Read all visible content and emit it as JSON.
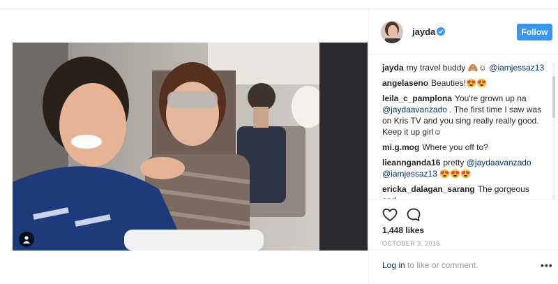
{
  "post": {
    "username": "jayda",
    "follow_label": "Follow",
    "likes": "1,448 likes",
    "date": "OCTOBER 3, 2016",
    "footer": {
      "login_link": "Log in",
      "login_rest": " to like or comment.",
      "more": "•••"
    }
  },
  "comments": [
    {
      "user": "jayda",
      "parts": [
        "my travel buddy 🙈☺ ",
        "@iamjessaz13"
      ]
    },
    {
      "user": "angelaseno",
      "parts": [
        "Beauties!😍😍"
      ]
    },
    {
      "user": "leila_c_pamplona",
      "parts": [
        "You're grown up na ",
        "@jaydaavanzado",
        " . The first time I saw was on Kris TV and you sing really really good. Keep it up girl☺"
      ]
    },
    {
      "user": "mi.g.mog",
      "parts": [
        "Where you off to?"
      ]
    },
    {
      "user": "lieannganda16",
      "parts": [
        "pretty ",
        "@jaydaavanzado",
        " ",
        "@iamjessaz13",
        " 😍😍😍"
      ]
    },
    {
      "user": "ericka_dalagan_sarang",
      "parts": [
        "The gorgeous and"
      ]
    }
  ],
  "icons": {
    "verified": "verified-badge-icon",
    "like": "heart-icon",
    "comment": "comment-bubble-icon",
    "tag": "user-tag-icon"
  },
  "colors": {
    "accent": "#3897f0",
    "link": "#003569",
    "muted": "#999999"
  }
}
